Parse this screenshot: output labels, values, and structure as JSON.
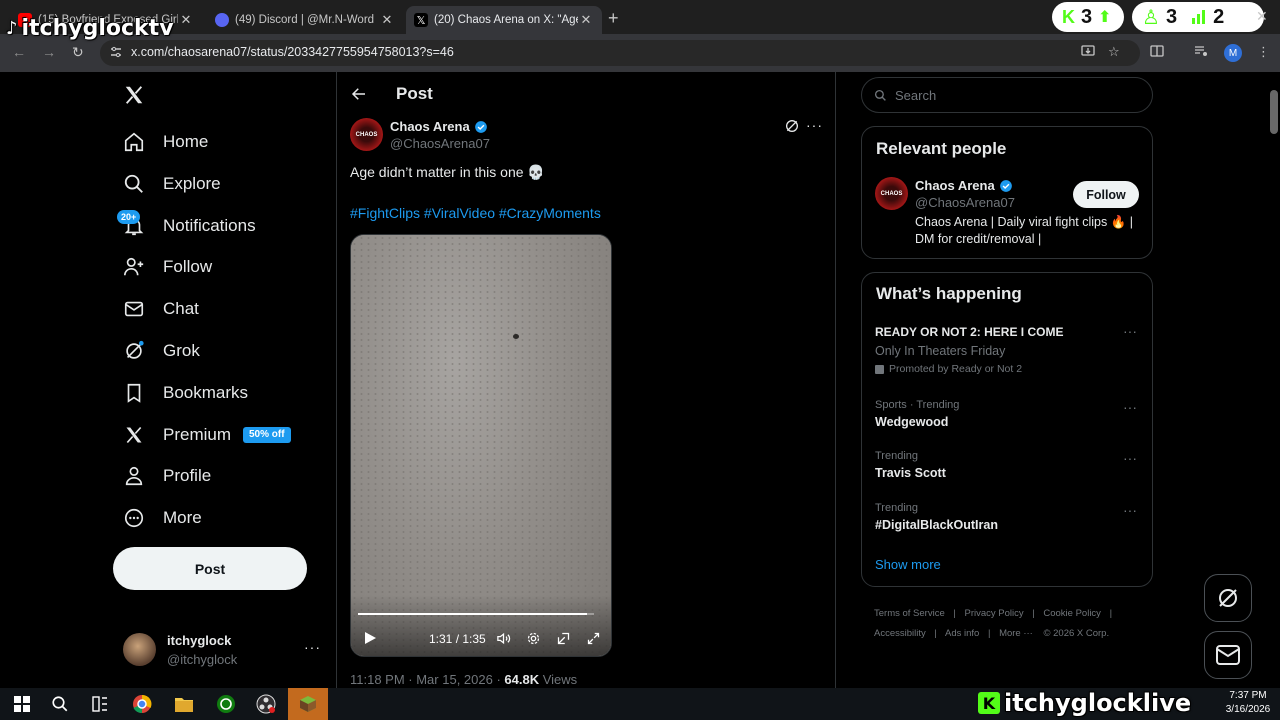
{
  "browser": {
    "tabs": [
      {
        "title": "(15) Boyfriend Exposed Girlfriend",
        "favicon": "youtube-icon",
        "active": false
      },
      {
        "title": "(49) Discord | @Mr.N-Word",
        "favicon": "discord-icon",
        "active": false
      },
      {
        "title": "(20) Chaos Arena on X: \"Age di",
        "favicon": "x-icon",
        "active": true
      }
    ],
    "url": "x.com/chaosarena07/status/2033427755954758013?s=46",
    "profile_initial": "M"
  },
  "overlay": {
    "streamer_name": "itchyglocktv",
    "live_name": "itchyglocklive",
    "stats": {
      "kick_viewers": "3",
      "followers": "3",
      "chart_count": "2"
    }
  },
  "nav": {
    "logo": "x-logo-icon",
    "items": [
      {
        "label": "Home",
        "icon": "home-icon"
      },
      {
        "label": "Explore",
        "icon": "search-icon"
      },
      {
        "label": "Notifications",
        "icon": "bell-icon"
      },
      {
        "label": "Follow",
        "icon": "person-add-icon"
      },
      {
        "label": "Chat",
        "icon": "envelope-icon"
      },
      {
        "label": "Grok",
        "icon": "grok-icon"
      },
      {
        "label": "Bookmarks",
        "icon": "bookmark-icon"
      },
      {
        "label": "Premium",
        "icon": "x-icon"
      },
      {
        "label": "Profile",
        "icon": "person-icon"
      },
      {
        "label": "More",
        "icon": "more-circle-icon"
      }
    ],
    "notifications_badge": "20+",
    "premium_badge": "50% off",
    "post_button": "Post",
    "account": {
      "name": "itchyglock",
      "handle": "@itchyglock"
    }
  },
  "post": {
    "header_title": "Post",
    "author": {
      "name": "Chaos Arena",
      "handle": "@ChaosArena07",
      "verified": true
    },
    "text": "Age didn’t matter in this one 💀",
    "hashtags": "#FightClips #ViralVideo #CrazyMoments",
    "video": {
      "time": "1:31 / 1:35",
      "progress": 0.97
    },
    "timestamp": "11:18 PM · Mar 15, 2026 · ",
    "views_count": "64.8K",
    "views_label": " Views"
  },
  "sidebar": {
    "search_placeholder": "Search",
    "relevant": {
      "title": "Relevant people",
      "name": "Chaos Arena",
      "handle": "@ChaosArena07",
      "bio": "Chaos Arena | Daily viral fight clips 🔥 | DM for credit/removal |",
      "follow_label": "Follow"
    },
    "happening": {
      "title": "What’s happening",
      "promo": {
        "headline": "READY OR NOT 2: HERE I COME",
        "sub": "Only In Theaters Friday",
        "promoted": "Promoted by Ready or Not 2"
      },
      "trends": [
        {
          "meta": "Sports · Trending",
          "name": "Wedgewood"
        },
        {
          "meta": "Trending",
          "name": "Travis Scott"
        },
        {
          "meta": "Trending",
          "name": "#DigitalBlackOutIran"
        }
      ],
      "show_more": "Show more"
    },
    "footer": {
      "terms": "Terms of Service",
      "privacy": "Privacy Policy",
      "cookie": "Cookie Policy",
      "access": "Accessibility",
      "ads": "Ads info",
      "more": "More ···",
      "copyright": "© 2026 X Corp."
    }
  },
  "taskbar": {
    "time": "7:37 PM",
    "date": "3/16/2026"
  },
  "colors": {
    "accent": "#1d9bf0",
    "background": "#000000",
    "border": "#2f3336",
    "muted": "#71767b"
  }
}
